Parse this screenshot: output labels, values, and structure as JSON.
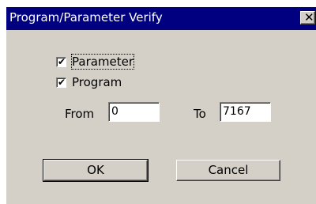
{
  "window": {
    "title": "Program/Parameter Verify",
    "close_icon": "close-icon"
  },
  "options": {
    "parameter": {
      "label": "Parameter",
      "checked": true
    },
    "program": {
      "label": "Program",
      "checked": true
    }
  },
  "range": {
    "from_label": "From",
    "from_value": "0",
    "to_label": "To",
    "to_value": "7167"
  },
  "buttons": {
    "ok": "OK",
    "cancel": "Cancel"
  },
  "colors": {
    "titlebar": "#000080",
    "face": "#d4d0c8"
  }
}
